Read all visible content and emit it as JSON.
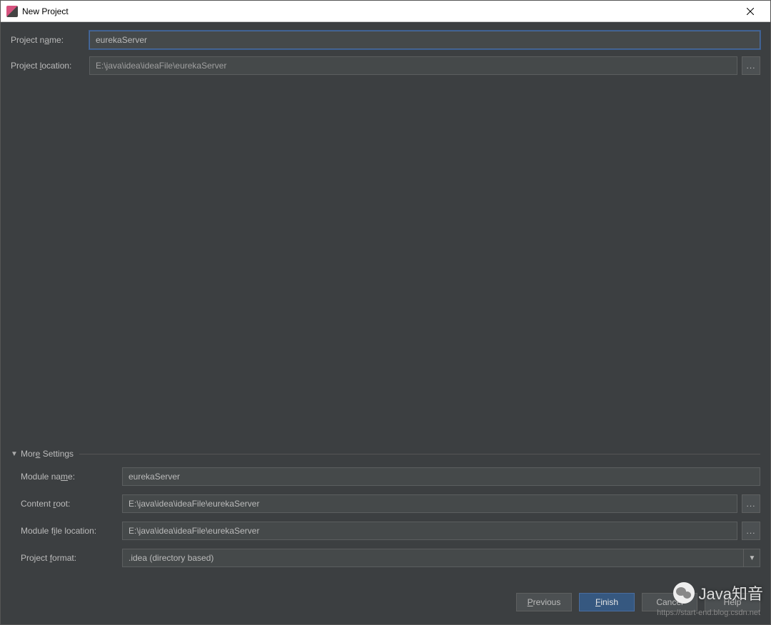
{
  "window": {
    "title": "New Project"
  },
  "fields": {
    "project_name": {
      "label": "Project name:",
      "value": "eurekaServer"
    },
    "project_location": {
      "label": "Project location:",
      "value": "E:\\java\\idea\\ideaFile\\eurekaServer"
    }
  },
  "more_settings": {
    "header": "More Settings",
    "module_name": {
      "label": "Module name:",
      "value": "eurekaServer"
    },
    "content_root": {
      "label": "Content root:",
      "value": "E:\\java\\idea\\ideaFile\\eurekaServer"
    },
    "module_file_location": {
      "label": "Module file location:",
      "value": "E:\\java\\idea\\ideaFile\\eurekaServer"
    },
    "project_format": {
      "label": "Project format:",
      "value": ".idea (directory based)"
    }
  },
  "buttons": {
    "previous": "Previous",
    "finish": "Finish",
    "cancel": "Cancel",
    "help": "Help",
    "browse": "..."
  },
  "watermark": {
    "text": "Java知音",
    "url": "https://start-end.blog.csdn.net"
  }
}
